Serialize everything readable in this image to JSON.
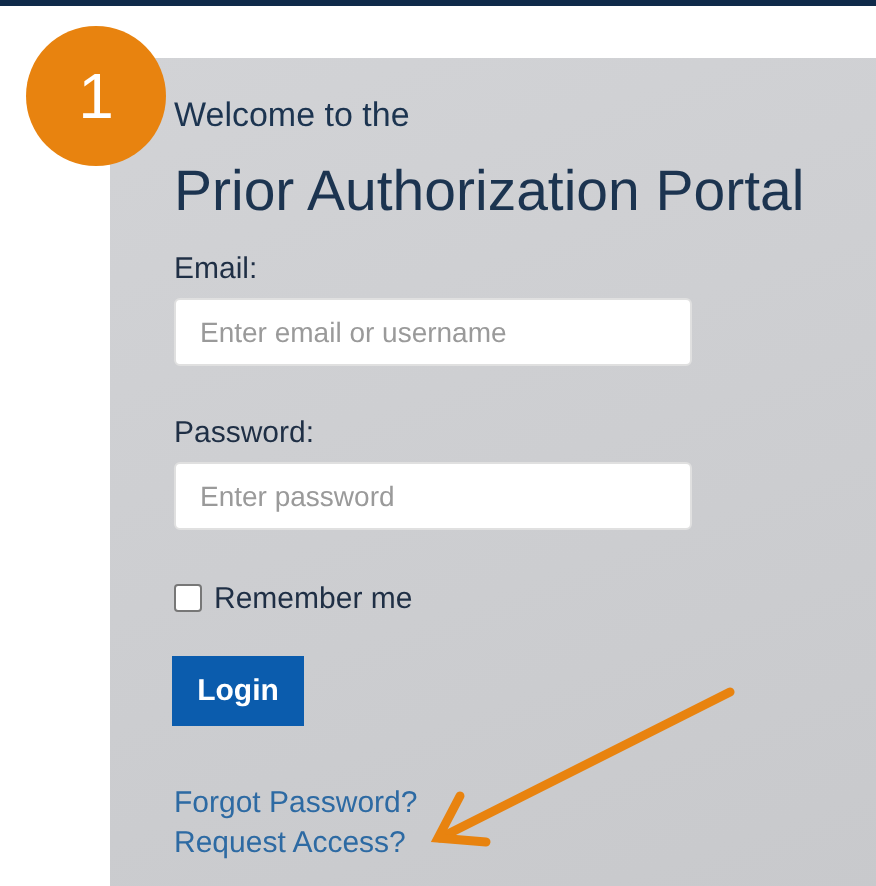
{
  "step_badge": "1",
  "welcome": "Welcome to the",
  "title": "Prior Authorization Portal",
  "fields": [
    {
      "label": "Email:",
      "placeholder": "Enter email or username"
    },
    {
      "label": "Password:",
      "placeholder": "Enter password"
    }
  ],
  "remember": {
    "label": "Remember me",
    "checked": false
  },
  "login_button": "Login",
  "links": [
    "Forgot Password?",
    "Request Access?"
  ]
}
